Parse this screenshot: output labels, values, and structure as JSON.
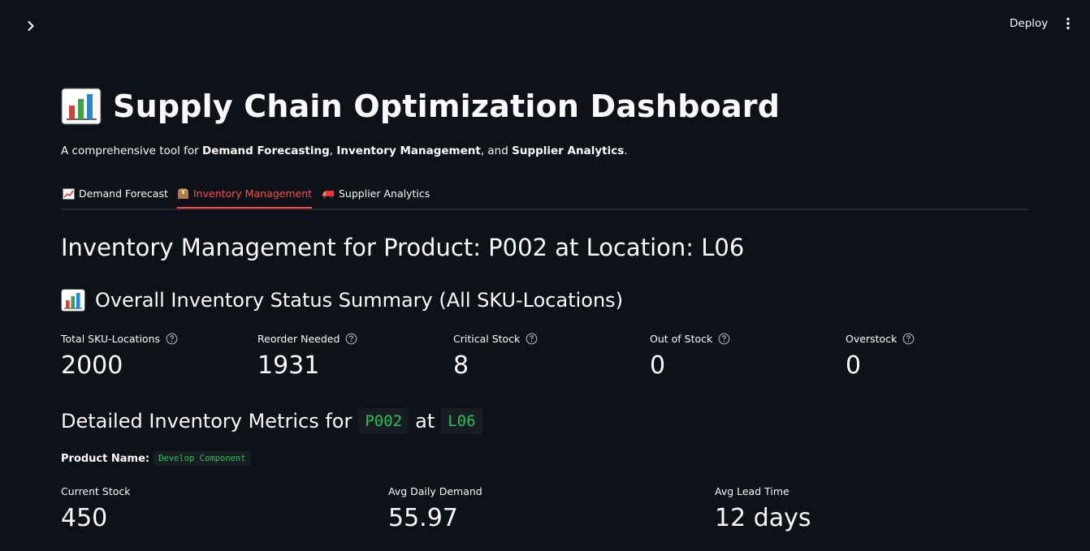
{
  "topbar": {
    "deploy_label": "Deploy"
  },
  "header": {
    "title": "Supply Chain Optimization Dashboard",
    "subtitle": {
      "prefix": "A comprehensive tool for ",
      "bold1": "Demand Forecasting",
      "sep1": ", ",
      "bold2": "Inventory Management",
      "sep2": ", and ",
      "bold3": "Supplier Analytics",
      "suffix": "."
    }
  },
  "tabs": [
    {
      "label": "Demand Forecast",
      "icon": "chart-increasing-icon",
      "active": false
    },
    {
      "label": "Inventory Management",
      "icon": "package-icon",
      "active": true
    },
    {
      "label": "Supplier Analytics",
      "icon": "truck-icon",
      "active": false
    }
  ],
  "inventory": {
    "heading": "Inventory Management for Product: P002 at Location: L06",
    "summary_heading": "Overall Inventory Status Summary (All SKU-Locations)",
    "summary_metrics": [
      {
        "label": "Total SKU-Locations",
        "value": "2000"
      },
      {
        "label": "Reorder Needed",
        "value": "1931"
      },
      {
        "label": "Critical Stock",
        "value": "8"
      },
      {
        "label": "Out of Stock",
        "value": "0"
      },
      {
        "label": "Overstock",
        "value": "0"
      }
    ],
    "detail_heading_prefix": "Detailed Inventory Metrics for",
    "detail_product": "P002",
    "detail_at": "at",
    "detail_location": "L06",
    "product_name_label": "Product Name:",
    "product_name_value": "Develop Component",
    "detail_metrics": [
      {
        "label": "Current Stock",
        "value": "450"
      },
      {
        "label": "Avg Daily Demand",
        "value": "55.97"
      },
      {
        "label": "Avg Lead Time",
        "value": "12 days"
      }
    ]
  },
  "colors": {
    "background": "#0e1117",
    "text": "#fafafa",
    "accent": "#ff4b4b",
    "code_text": "#21c354",
    "code_bg": "#1a1c24"
  }
}
